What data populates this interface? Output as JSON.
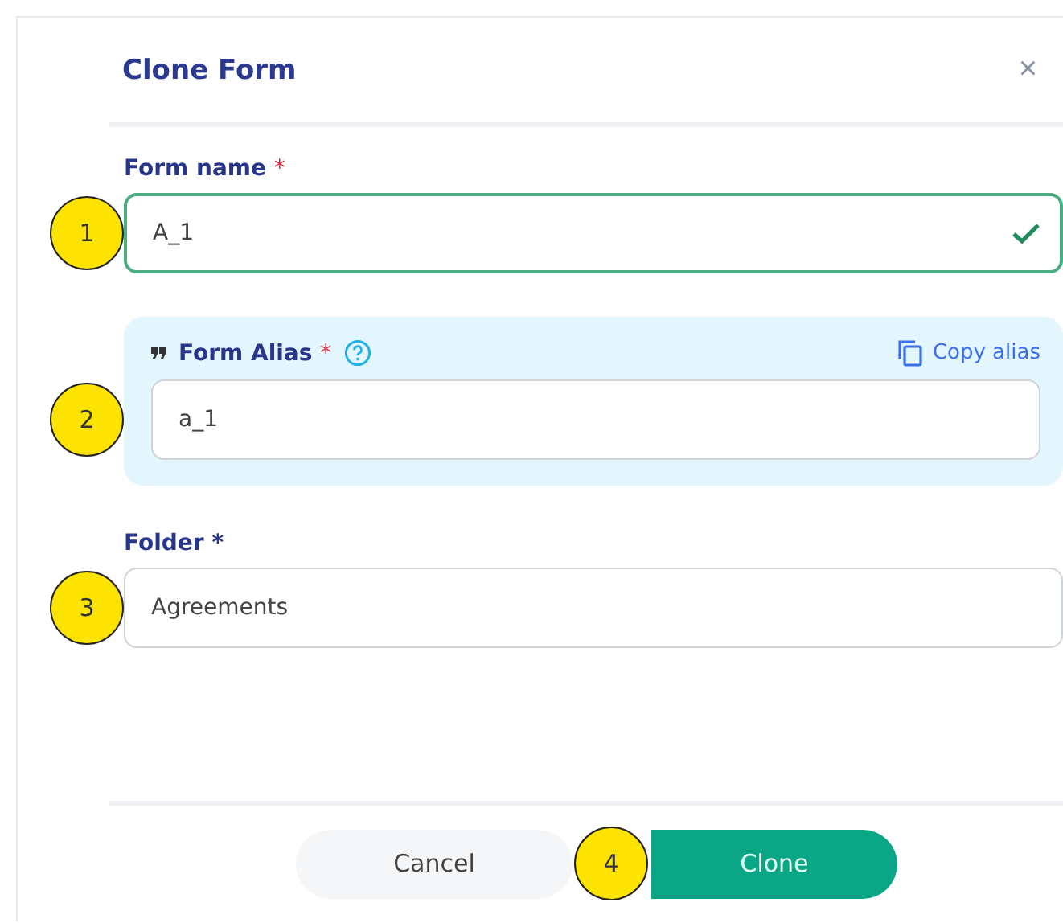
{
  "dialog": {
    "title": "Clone Form",
    "close": "×"
  },
  "form_name": {
    "label": "Form name",
    "required": "*",
    "value": "A_1",
    "valid": true,
    "callout": "1"
  },
  "form_alias": {
    "label": "Form Alias",
    "required": "*",
    "copy_action": "Copy alias",
    "value": "a_1",
    "callout": "2"
  },
  "folder": {
    "label": "Folder",
    "required": "*",
    "value": "Agreements",
    "callout": "3"
  },
  "buttons": [
    {
      "label": "Cancel",
      "kind": "secondary"
    },
    {
      "label": "Clone",
      "kind": "primary",
      "callout": "4"
    }
  ]
}
